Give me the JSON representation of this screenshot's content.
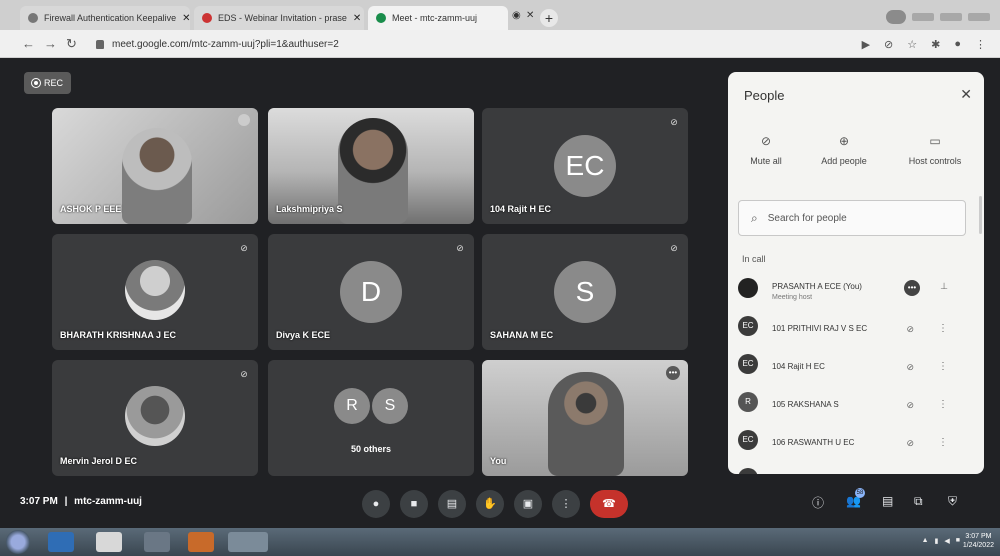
{
  "browser": {
    "tabs": [
      {
        "label": "Firewall Authentication Keepalive",
        "active": false
      },
      {
        "label": "EDS - Webinar Invitation - prase",
        "active": false
      },
      {
        "label": "Meet - mtc-zamm-uuj",
        "active": true
      }
    ],
    "url": "meet.google.com/mtc-zamm-uuj?pli=1&authuser=2"
  },
  "meet": {
    "rec_label": "REC",
    "tiles": [
      {
        "name": "ASHOK P EEE"
      },
      {
        "name": "Lakshmipriya S"
      },
      {
        "name": "104 Rajit H EC",
        "initials": "EC"
      },
      {
        "name": "BHARATH KRISHNAA J EC"
      },
      {
        "name": "Divya K ECE",
        "initials": "D"
      },
      {
        "name": "SAHANA M EC",
        "initials": "S"
      },
      {
        "name": "Mervin Jerol D EC"
      },
      {
        "name": "50 others",
        "initials": [
          "R",
          "S"
        ]
      },
      {
        "name": "You"
      }
    ],
    "clock": "3:07 PM",
    "meeting_code": "mtc-zamm-uuj",
    "separator": "|",
    "participant_badge": "58"
  },
  "people": {
    "title": "People",
    "actions": [
      {
        "label": "Mute all",
        "icon": "mic-off-icon"
      },
      {
        "label": "Add people",
        "icon": "add-person-icon"
      },
      {
        "label": "Host controls",
        "icon": "host-controls-icon"
      }
    ],
    "search_placeholder": "Search for people",
    "section": "In call",
    "list": [
      {
        "name": "PRASANTH A ECE (You)",
        "sub": "Meeting host",
        "avatar": ""
      },
      {
        "name": "101 PRITHIVI RAJ V S EC",
        "avatar": "EC"
      },
      {
        "name": "104 Rajit H EC",
        "avatar": "EC"
      },
      {
        "name": "105 RAKSHANA S",
        "avatar": "R"
      },
      {
        "name": "106 RASWANTH U EC",
        "avatar": "EC"
      }
    ]
  },
  "taskbar": {
    "time": "3:07 PM",
    "date": "1/24/2022"
  }
}
